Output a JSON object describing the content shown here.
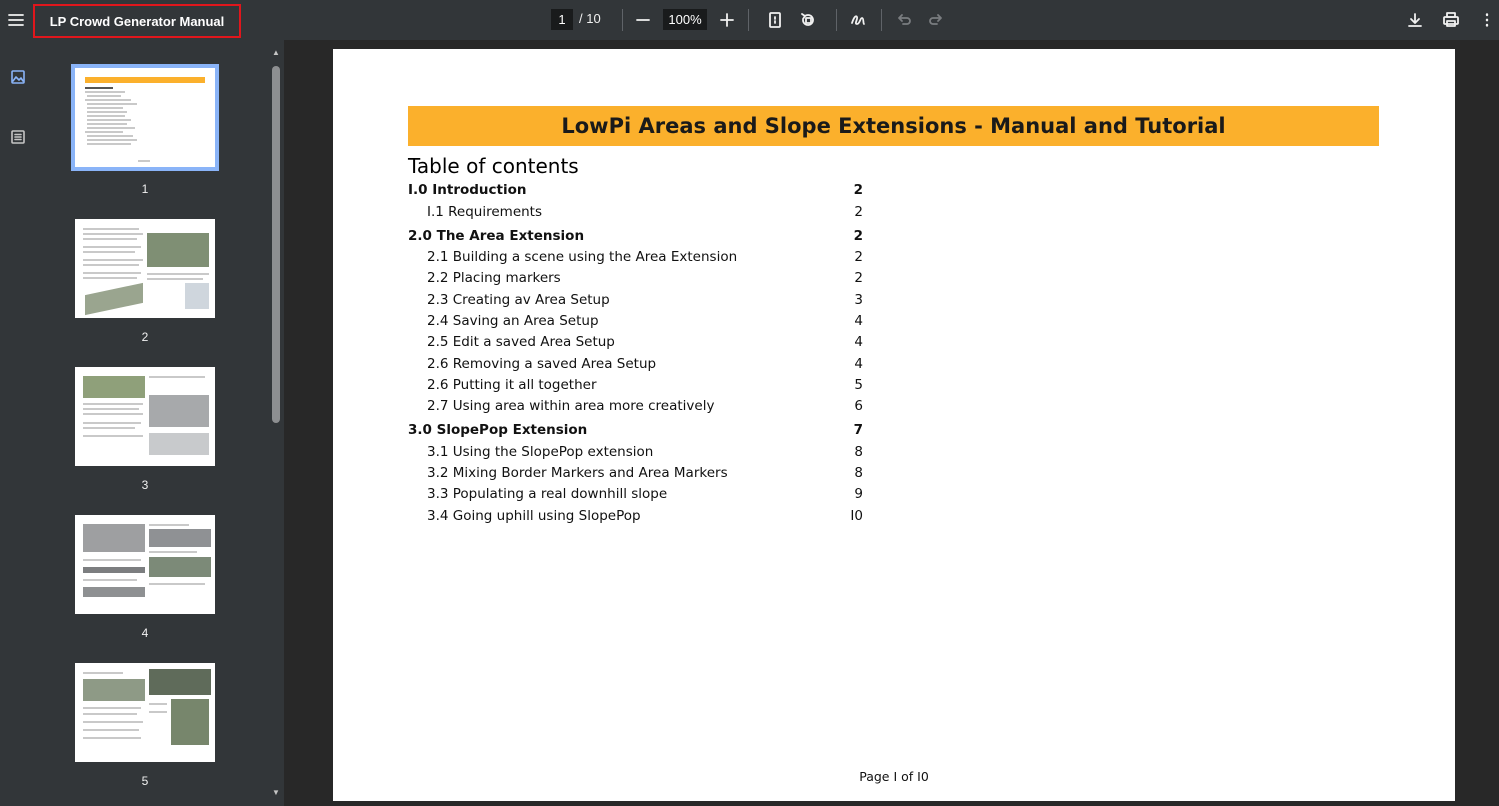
{
  "toolbar": {
    "document_title": "LP Crowd Generator Manual",
    "current_page": "1",
    "page_total": "/ 10",
    "zoom": "100%"
  },
  "sidebar": {
    "thumbnails": [
      {
        "label": "1",
        "selected": true
      },
      {
        "label": "2"
      },
      {
        "label": "3"
      },
      {
        "label": "4"
      },
      {
        "label": "5"
      }
    ]
  },
  "document": {
    "banner_title": "LowPi Areas and Slope Extensions - Manual and Tutorial",
    "banner_color": "#fbb02c",
    "toc_heading": "Table of contents",
    "toc": [
      {
        "label": "I.0 Introduction",
        "page": "2",
        "level": "main"
      },
      {
        "label": "I.1 Requirements",
        "page": "2",
        "level": "sub"
      },
      {
        "label": "2.0 The Area Extension",
        "page": "2",
        "level": "main"
      },
      {
        "label": "2.1 Building a scene using the Area Extension",
        "page": "2",
        "level": "sub"
      },
      {
        "label": "2.2 Placing markers",
        "page": "2",
        "level": "sub"
      },
      {
        "label": "2.3 Creating av Area Setup",
        "page": "3",
        "level": "sub"
      },
      {
        "label": "2.4 Saving an Area Setup",
        "page": "4",
        "level": "sub"
      },
      {
        "label": "2.5 Edit a saved Area Setup",
        "page": "4",
        "level": "sub"
      },
      {
        "label": "2.6 Removing a saved Area Setup",
        "page": "4",
        "level": "sub"
      },
      {
        "label": "2.6 Putting it all together",
        "page": "5",
        "level": "sub"
      },
      {
        "label": "2.7 Using area within area more creatively",
        "page": "6",
        "level": "sub"
      },
      {
        "label": "3.0 SlopePop Extension",
        "page": "7",
        "level": "main"
      },
      {
        "label": "3.1 Using the SlopePop extension",
        "page": "8",
        "level": "sub"
      },
      {
        "label": "3.2 Mixing Border Markers and Area Markers",
        "page": "8",
        "level": "sub"
      },
      {
        "label": "3.3 Populating a real downhill slope",
        "page": "9",
        "level": "sub"
      },
      {
        "label": "3.4 Going uphill using SlopePop",
        "page": "I0",
        "level": "sub"
      }
    ],
    "footer": "Page I of I0"
  },
  "colors": {
    "toolbar_bg": "#323639",
    "viewer_bg": "#282828",
    "selection_outline": "#8ab4f8",
    "title_highlight": "#e0161c"
  }
}
